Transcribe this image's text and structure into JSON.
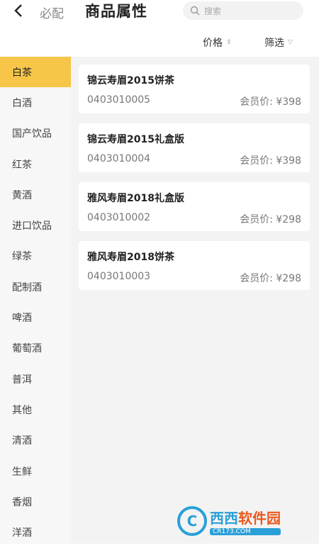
{
  "header": {
    "back_icon": "chevron-left-icon",
    "subtitle": "必配",
    "title": "商品属性",
    "search": {
      "icon": "search-icon",
      "placeholder": "搜索"
    }
  },
  "sortbar": {
    "price_label": "价格",
    "price_arrow": "⇕",
    "filter_label": "筛选",
    "filter_icon": "▽"
  },
  "sidebar": {
    "items": [
      {
        "label": "白茶",
        "active": true
      },
      {
        "label": "白酒"
      },
      {
        "label": "国产饮品"
      },
      {
        "label": "红茶"
      },
      {
        "label": "黄酒"
      },
      {
        "label": "进口饮品"
      },
      {
        "label": "绿茶"
      },
      {
        "label": "配制酒"
      },
      {
        "label": "啤酒"
      },
      {
        "label": "葡萄酒"
      },
      {
        "label": "普洱"
      },
      {
        "label": "其他"
      },
      {
        "label": "清酒"
      },
      {
        "label": "生鲜"
      },
      {
        "label": "香烟"
      },
      {
        "label": "洋酒"
      }
    ]
  },
  "products": [
    {
      "name": "锦云寿眉2015饼茶",
      "code": "0403010005",
      "price": "会员价: ¥398"
    },
    {
      "name": "锦云寿眉2015礼盒版",
      "code": "0403010004",
      "price": "会员价: ¥398"
    },
    {
      "name": "雅风寿眉2018礼盒版",
      "code": "0403010002",
      "price": "会员价: ¥298"
    },
    {
      "name": "雅风寿眉2018饼茶",
      "code": "0403010003",
      "price": "会员价: ¥298"
    }
  ],
  "watermark": {
    "brand": "西西",
    "suffix": "软件园",
    "domain": "CR173.COM"
  },
  "colors": {
    "accent": "#f7c548",
    "main_bg": "#f3f3f3",
    "sidebar_bg": "#f7f7f7"
  }
}
